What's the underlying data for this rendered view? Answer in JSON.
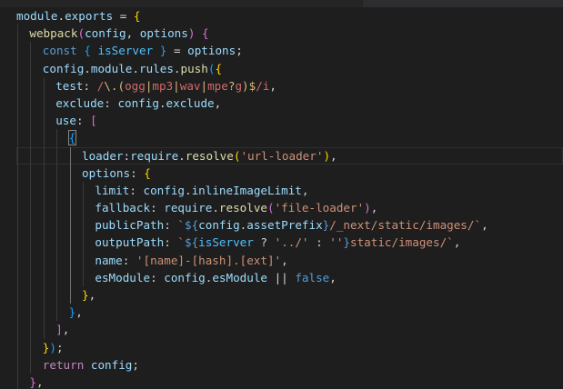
{
  "editor": {
    "language": "javascript",
    "theme_colors": {
      "background": "#1e1e1e",
      "identifier": "#9cdcfe",
      "function": "#dcdcaa",
      "keyword": "#569cd6",
      "control": "#c586c0",
      "string": "#ce9178",
      "regex": "#d16969",
      "bracket_level1": "#ffd700",
      "bracket_level2": "#da70d6",
      "bracket_level3": "#179fff"
    },
    "lines": [
      {
        "indent": 0,
        "text": "module.exports = {"
      },
      {
        "indent": 1,
        "text": "webpack(config, options) {"
      },
      {
        "indent": 2,
        "text": "const { isServer } = options;"
      },
      {
        "indent": 2,
        "text": "config.module.rules.push({"
      },
      {
        "indent": 3,
        "text": "test: /\\.(ogg|mp3|wav|mpe?g)$/i,"
      },
      {
        "indent": 3,
        "text": "exclude: config.exclude,"
      },
      {
        "indent": 3,
        "text": "use: ["
      },
      {
        "indent": 4,
        "text": "{"
      },
      {
        "indent": 5,
        "text": "loader:require.resolve('url-loader'),"
      },
      {
        "indent": 5,
        "text": "options: {"
      },
      {
        "indent": 6,
        "text": "limit: config.inlineImageLimit,"
      },
      {
        "indent": 6,
        "text": "fallback: require.resolve('file-loader'),"
      },
      {
        "indent": 6,
        "text": "publicPath: `${config.assetPrefix}/_next/static/images/`,"
      },
      {
        "indent": 6,
        "text": "outputPath: `${isServer ? '../' : ''}static/images/`,"
      },
      {
        "indent": 6,
        "text": "name: '[name]-[hash].[ext]',"
      },
      {
        "indent": 6,
        "text": "esModule: config.esModule || false,"
      },
      {
        "indent": 5,
        "text": "},"
      },
      {
        "indent": 4,
        "text": "},"
      },
      {
        "indent": 3,
        "text": "],"
      },
      {
        "indent": 2,
        "text": "});"
      },
      {
        "indent": 2,
        "text": "return config;"
      },
      {
        "indent": 1,
        "text": "},"
      },
      {
        "indent": 0,
        "text": "};"
      }
    ]
  }
}
